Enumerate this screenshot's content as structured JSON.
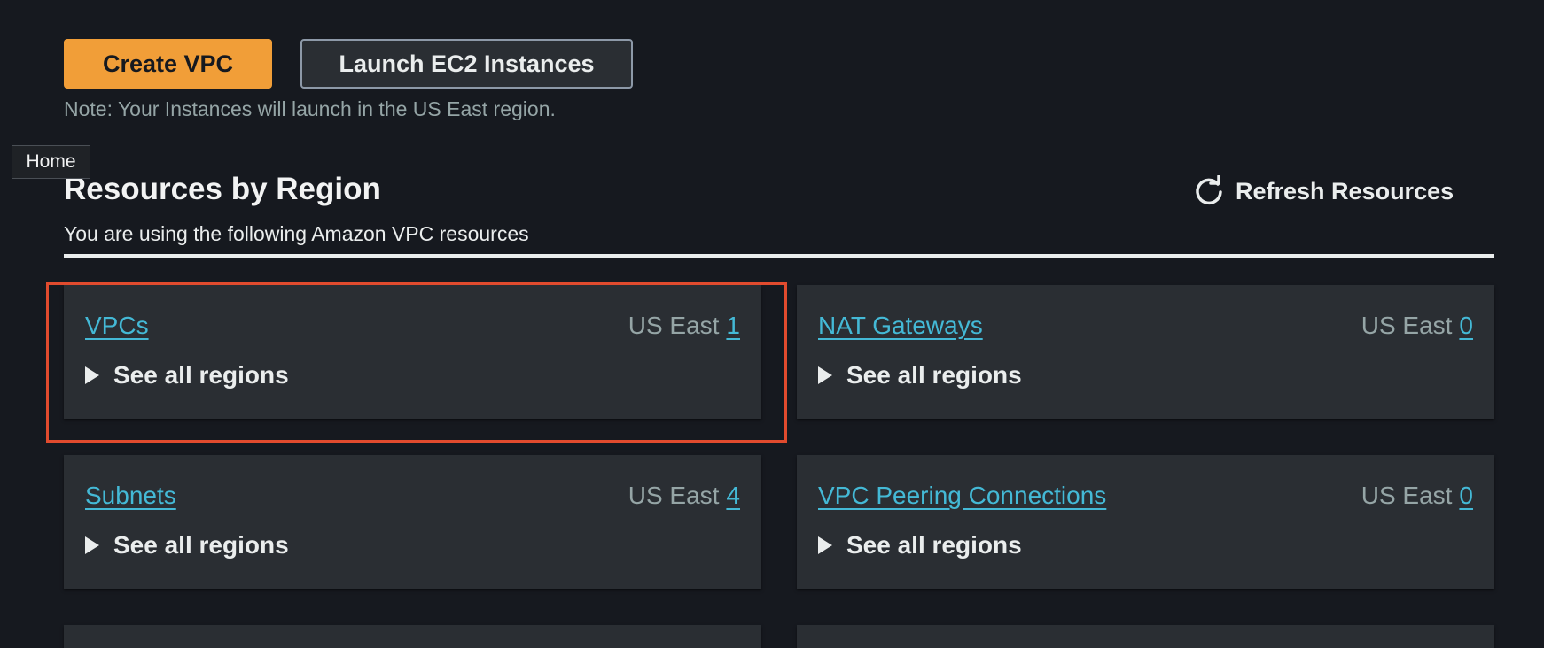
{
  "actions": {
    "create_vpc_label": "Create VPC",
    "launch_ec2_label": "Launch EC2 Instances",
    "note": "Note: Your Instances will launch in the US East region."
  },
  "tooltip": {
    "text": "Home"
  },
  "section": {
    "title": "Resources by Region",
    "description": "You are using the following Amazon VPC resources",
    "refresh_label": "Refresh Resources",
    "refresh_icon": "refresh-icon"
  },
  "cards": [
    {
      "title": "VPCs",
      "region": "US East",
      "count": "1",
      "expand_label": "See all regions"
    },
    {
      "title": "NAT Gateways",
      "region": "US East",
      "count": "0",
      "expand_label": "See all regions"
    },
    {
      "title": "Subnets",
      "region": "US East",
      "count": "4",
      "expand_label": "See all regions"
    },
    {
      "title": "VPC Peering Connections",
      "region": "US East",
      "count": "0",
      "expand_label": "See all regions"
    }
  ],
  "colors": {
    "background": "#16191f",
    "primary_button": "#f19e38",
    "link": "#44b9d6",
    "card": "#2a2e33",
    "highlight": "#e14b2e"
  }
}
